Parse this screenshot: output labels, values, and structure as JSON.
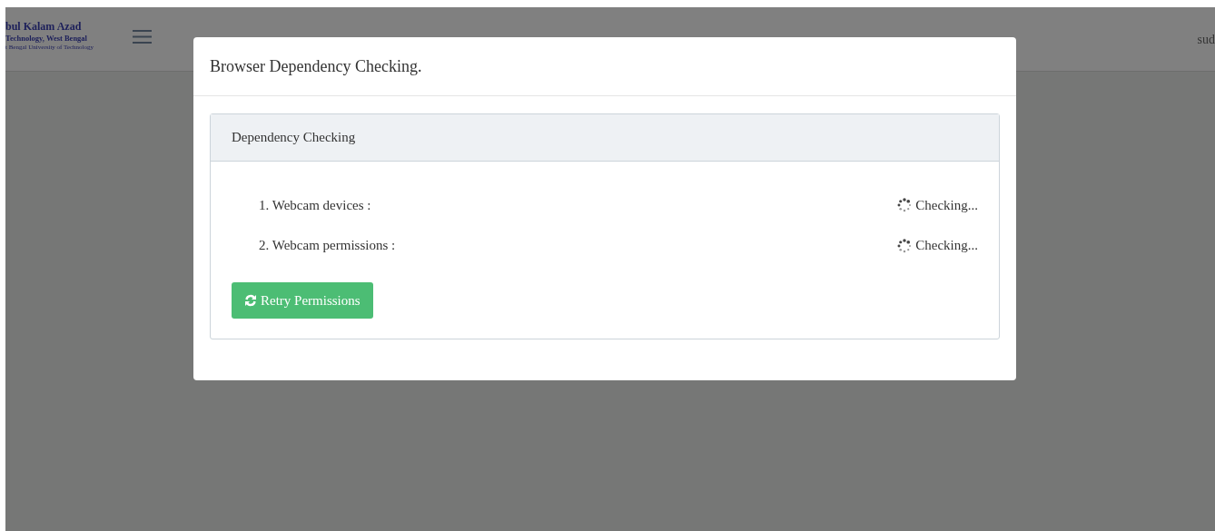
{
  "header": {
    "logo_lines": [
      "bul Kalam Azad",
      "Technology, West Bengal",
      "t Bengal University of Technology"
    ],
    "user": "sud"
  },
  "modal": {
    "title": "Browser Dependency Checking.",
    "panel_title": "Dependency Checking",
    "checks": [
      {
        "label": "1. Webcam devices :",
        "status": "Checking..."
      },
      {
        "label": "2. Webcam permissions :",
        "status": "Checking..."
      }
    ],
    "button": "Retry Permissions"
  }
}
